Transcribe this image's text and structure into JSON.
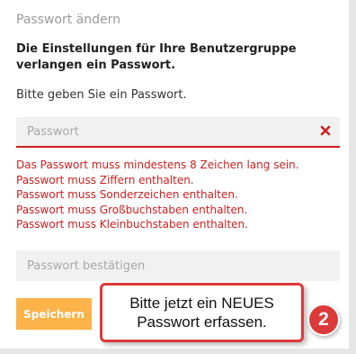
{
  "panel": {
    "title": "Passwort ändern",
    "notice": "Die Einstellungen für Ihre Benutzergruppe verlangen ein Passwort.",
    "prompt": "Bitte geben Sie ein Passwort."
  },
  "password_field": {
    "placeholder": "Passwort",
    "value": "",
    "clear_icon": "close-x-icon"
  },
  "errors": [
    "Das Passwort muss mindestens 8 Zeichen lang sein.",
    "Passwort muss Ziffern enthalten.",
    "Passwort muss Sonderzeichen enthalten.",
    "Passwort muss Großbuchstaben enthalten.",
    "Passwort muss Kleinbuchstaben enthalten."
  ],
  "confirm_field": {
    "placeholder": "Passwort bestätigen",
    "value": ""
  },
  "save_button": {
    "label": "Speichern"
  },
  "annotation": {
    "callout_text": "Bitte jetzt ein NEUES\nPasswort erfassen.",
    "step_number": "2"
  },
  "colors": {
    "error": "#cc1f1f",
    "accent_button": "#fbb34a",
    "annotation_red": "#dc3a3a"
  }
}
